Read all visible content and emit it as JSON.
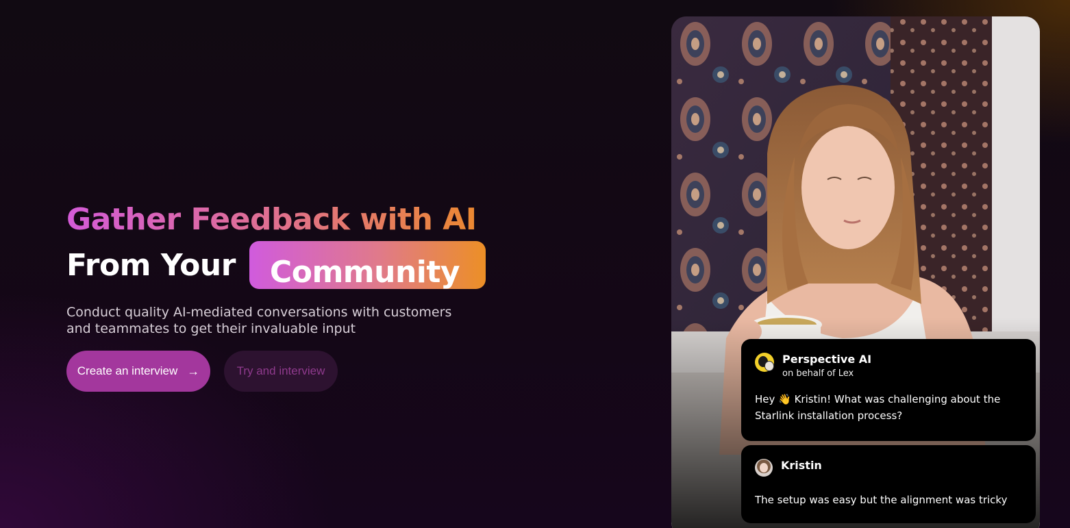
{
  "hero": {
    "headline_line1": "Gather Feedback with AI",
    "headline_line2": "From Your",
    "headline_highlight": "Community",
    "subtitle": "Conduct quality AI-mediated conversations with customers and teammates to get their invaluable input",
    "primary_cta": "Create an interview",
    "secondary_cta": "Try and interview"
  },
  "chat": {
    "ai_message": {
      "sender": "Perspective AI",
      "sender_sub": "on behalf of Lex",
      "text": "Hey 👋 Kristin! What was challenging about the Starlink installation process?"
    },
    "user_message": {
      "sender": "Kristin",
      "text": "The setup was easy but the alignment was tricky"
    }
  },
  "colors": {
    "background": "#120713",
    "primary_button": "#a3379d",
    "secondary_button": "#2d1230",
    "gradient_start": "#d05bdd",
    "gradient_end": "#ec8f26"
  },
  "icons": {
    "cta_arrow": "arrow-right-icon"
  }
}
